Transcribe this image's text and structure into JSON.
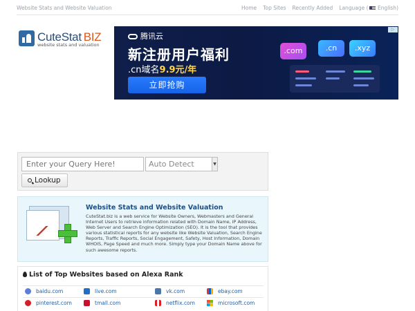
{
  "header": {
    "tagline": "Website Stats and Website Valuation",
    "nav": [
      "Home",
      "Top Sites",
      "Recently Added"
    ],
    "language_label": "Language (",
    "language_value": "English)"
  },
  "logo": {
    "name": "CuteStat",
    "name_suffix": "BIZ",
    "subtitle": "website stats and valuation"
  },
  "ad": {
    "close": "▷",
    "brand": "腾讯云",
    "headline": "新注册用户福利",
    "sub_prefix": ".cn域名",
    "sub_price": "9.9元/年",
    "cta": "立即抢购",
    "tiles": [
      ".com",
      ".cn",
      ".xyz"
    ]
  },
  "search": {
    "placeholder": "Enter your Query Here!",
    "detect_value": "Auto Detect",
    "lookup_label": "Lookup"
  },
  "info": {
    "title": "Website Stats and Website Valuation",
    "text": "CuteStat.biz is a web service for Website Owners, Webmasters and General Internet Users to retrieve information related with Domain Name, IP Address, Web Server and Search Engine Optimization (SEO). It is the tool that provides various statistical reports for any website like Website Valuation, Search Engine Reports, Traffic Reports, Social Engagement, Safety, Host Information, Domain WHOIS, Page Speed and much more. Simply type your Domain Name above for such awesome reports."
  },
  "top_sites": {
    "title": "List of Top Websites based on Alexa Rank",
    "rows": [
      [
        {
          "name": "baidu.com",
          "icon": "baidu-icon",
          "color": "#5b7fd6"
        },
        {
          "name": "live.com",
          "icon": "live-icon",
          "color": "#1d6fc7"
        },
        {
          "name": "vk.com",
          "icon": "vk-icon",
          "color": "#4a76a8"
        },
        {
          "name": "ebay.com",
          "icon": "ebay-icon",
          "color": "#e6a21a"
        }
      ],
      [
        {
          "name": "pinterest.com",
          "icon": "pinterest-icon",
          "color": "#d51f28"
        },
        {
          "name": "tmall.com",
          "icon": "tmall-icon",
          "color": "#c8102e"
        },
        {
          "name": "netflix.com",
          "icon": "netflix-icon",
          "color": "#d81f26"
        },
        {
          "name": "microsoft.com",
          "icon": "microsoft-icon",
          "color": "#f25022"
        }
      ]
    ]
  }
}
